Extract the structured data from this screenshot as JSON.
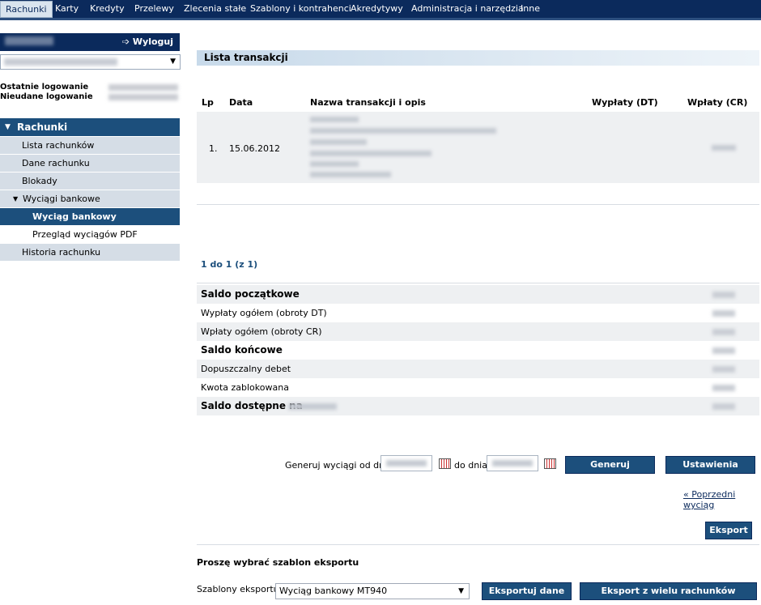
{
  "topnav": {
    "items": [
      {
        "label": "Rachunki",
        "active": true
      },
      {
        "label": "Karty"
      },
      {
        "label": "Kredyty"
      },
      {
        "label": "Przelewy"
      },
      {
        "label": "Zlecenia stałe"
      },
      {
        "label": "Szablony i kontrahenci"
      },
      {
        "label": "Akredytywy"
      },
      {
        "label": "Administracja i narzędzia"
      },
      {
        "label": "Inne"
      }
    ]
  },
  "sidebar": {
    "logout_label": "Wyloguj",
    "last_login_label": "Ostatnie logowanie",
    "failed_login_label": "Nieudane logowanie",
    "section_label": "Rachunki",
    "items": [
      {
        "label": "Lista rachunków"
      },
      {
        "label": "Dane rachunku"
      },
      {
        "label": "Blokady"
      },
      {
        "label": "Wyciągi bankowe"
      },
      {
        "label": "Wyciąg bankowy"
      },
      {
        "label": "Przegląd wyciągów PDF"
      },
      {
        "label": "Historia rachunku"
      }
    ]
  },
  "main": {
    "title": "Lista transakcji",
    "columns": {
      "lp": "Lp",
      "date": "Data",
      "name": "Nazwa transakcji i opis",
      "debit": "Wypłaty (DT)",
      "credit": "Wpłaty (CR)"
    },
    "rows": [
      {
        "lp": "1.",
        "date": "15.06.2012"
      }
    ],
    "pager": "1 do 1 (z 1)",
    "summary": [
      {
        "label": "Saldo początkowe",
        "bold": true
      },
      {
        "label": "Wypłaty ogółem (obroty DT)"
      },
      {
        "label": "Wpłaty ogółem (obroty CR)"
      },
      {
        "label": "Saldo końcowe",
        "bold": true
      },
      {
        "label": "Dopuszczalny debet"
      },
      {
        "label": "Kwota zablokowana"
      },
      {
        "label": "Saldo dostępne na",
        "bold": true
      }
    ],
    "generate": {
      "from_label": "Generuj wyciągi od dnia",
      "to_label": "do dnia",
      "generate_button": "Generuj",
      "settings_button": "Ustawienia"
    },
    "prev_link": "« Poprzedni wyciąg",
    "export_button": "Eksport",
    "export_title": "Proszę wybrać szablon eksportu",
    "templates_label": "Szablony eksportu",
    "template_selected": "Wyciąg bankowy MT940",
    "export_data_button": "Eksportuj dane",
    "export_multi_button": "Eksport z wielu rachunków"
  }
}
